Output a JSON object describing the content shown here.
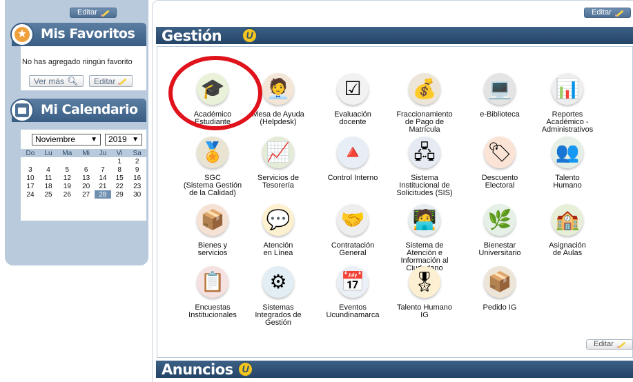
{
  "edit_label": "Editar",
  "sidebar": {
    "favorites": {
      "title": "Mis Favoritos",
      "empty_text": "No has agregado ningún favorito",
      "see_more_label": "Ver más",
      "edit_label": "Editar"
    },
    "calendar": {
      "title": "Mi Calendario",
      "month": "Noviembre",
      "year": "2019",
      "weekdays": [
        "Do",
        "Lu",
        "Ma",
        "Mi",
        "Ju",
        "Vi",
        "Sa"
      ],
      "weeks": [
        [
          "",
          "",
          "",
          "",
          "",
          "1",
          "2"
        ],
        [
          "3",
          "4",
          "5",
          "6",
          "7",
          "8",
          "9"
        ],
        [
          "10",
          "11",
          "12",
          "13",
          "14",
          "15",
          "16"
        ],
        [
          "17",
          "18",
          "19",
          "20",
          "21",
          "22",
          "23"
        ],
        [
          "24",
          "25",
          "26",
          "27",
          "28",
          "29",
          "30"
        ]
      ],
      "today": "28"
    }
  },
  "main": {
    "gestion_title": "Gestión",
    "anuncios_title": "Anuncios",
    "logo_glyph": "U",
    "tiles": [
      {
        "label": "Académico\nEstudiante",
        "icon": "student-icon",
        "glyph": "🎓",
        "bg": "#e9f1d9"
      },
      {
        "label": "Mesa de Ayuda\n(Helpdesk)",
        "icon": "helpdesk-icon",
        "glyph": "🧑‍💼",
        "bg": "#f3e6d6"
      },
      {
        "label": "Evaluación\ndocente",
        "icon": "checklist-icon",
        "glyph": "☑",
        "bg": "#f2f2f2"
      },
      {
        "label": "Fraccionamiento\nde Pago de\nMatrícula",
        "icon": "money-bag-icon",
        "glyph": "💰",
        "bg": "#ede6d8"
      },
      {
        "label": "e-Biblioteca",
        "icon": "laptop-icon",
        "glyph": "💻",
        "bg": "#e4e4e4"
      },
      {
        "label": "Reportes\nAcadémico -\nAdministrativos",
        "icon": "report-icon",
        "glyph": "📊",
        "bg": "#eeeeee"
      },
      {
        "label": "SGC\n(Sistema Gestión\nde la Calidad)",
        "icon": "quality-icon",
        "glyph": "🏅",
        "bg": "#e9e3d2"
      },
      {
        "label": "Servicios de\nTesorería",
        "icon": "treasury-icon",
        "glyph": "📈",
        "bg": "#e4ecd8"
      },
      {
        "label": "Control Interno",
        "icon": "control-icon",
        "glyph": "🔺",
        "bg": "#e8eef6"
      },
      {
        "label": "Sistema\nInstitucional de\nSolicitudes (SIS)",
        "icon": "network-icon",
        "glyph": "🖧",
        "bg": "#e6eaf2"
      },
      {
        "label": "Descuento\nElectoral",
        "icon": "discount-icon",
        "glyph": "🏷",
        "bg": "#fbe4d6"
      },
      {
        "label": "Talento\nHumano",
        "icon": "people-icon",
        "glyph": "👥",
        "bg": "#e6efe6"
      },
      {
        "label": "Bienes y\nservicios",
        "icon": "goods-icon",
        "glyph": "📦",
        "bg": "#f5e2d4"
      },
      {
        "label": "Atención\nen Línea",
        "icon": "chat-icon",
        "glyph": "💬",
        "bg": "#fdf1cf"
      },
      {
        "label": "Contratación\nGeneral",
        "icon": "handshake-icon",
        "glyph": "🤝",
        "bg": "#eeeeee"
      },
      {
        "label": "Sistema de\nAtención e\nInformación al\nCiudadano",
        "icon": "citizen-icon",
        "glyph": "🧑‍💻",
        "bg": "#e7eef0"
      },
      {
        "label": "Bienestar\nUniversitario",
        "icon": "wellbeing-icon",
        "glyph": "🌿",
        "bg": "#e6f0e6"
      },
      {
        "label": "Asignación\nde Aulas",
        "icon": "classroom-icon",
        "glyph": "🏫",
        "bg": "#e8efd8"
      },
      {
        "label": "Encuestas\nInstitucionales",
        "icon": "survey-icon",
        "glyph": "📋",
        "bg": "#f6e1e1"
      },
      {
        "label": "Sistemas\nIntegrados de\nGestión",
        "icon": "integrated-icon",
        "glyph": "⚙",
        "bg": "#e2eef4"
      },
      {
        "label": "Eventos\nUcundinamarca",
        "icon": "calendar-event-icon",
        "glyph": "📅",
        "bg": "#eaf0f6"
      },
      {
        "label": "Talento Humano\nIG",
        "icon": "award-icon",
        "glyph": "🎖",
        "bg": "#fdf0d2"
      },
      {
        "label": "Pedido IG",
        "icon": "order-icon",
        "glyph": "📦",
        "bg": "#ede6d8"
      }
    ]
  }
}
